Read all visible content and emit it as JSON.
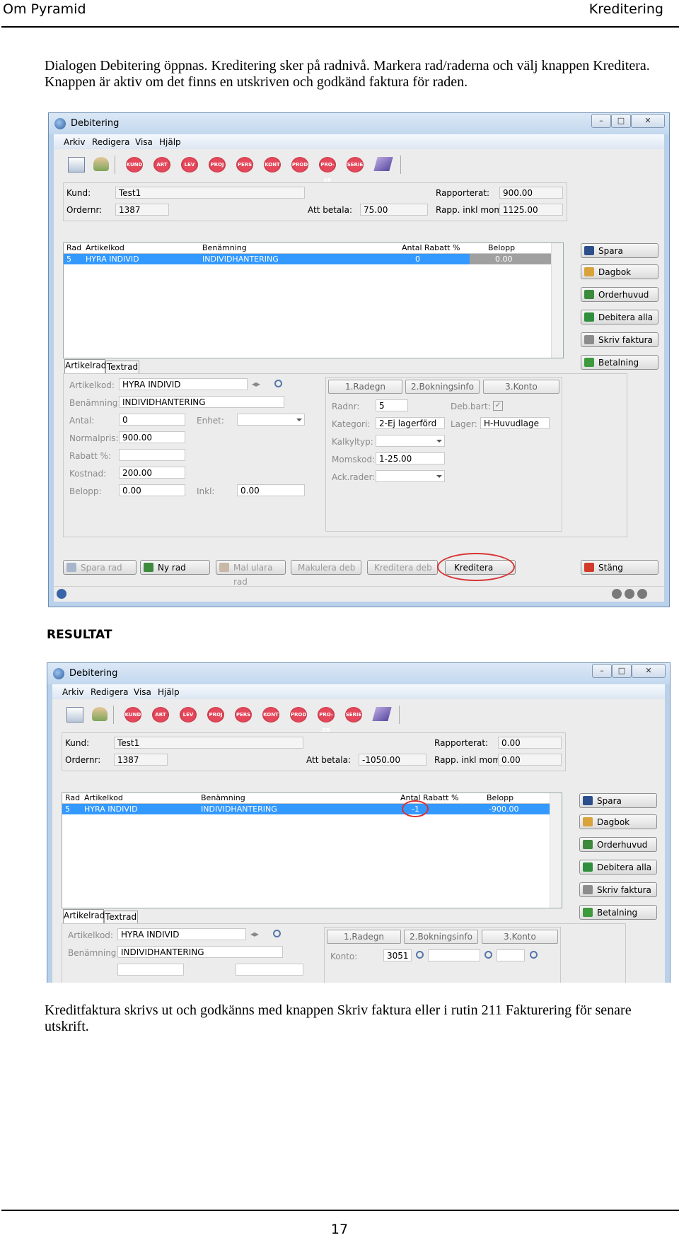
{
  "page": {
    "header_left": "Om Pyramid",
    "header_right": "Kreditering",
    "intro_paragraph": "Dialogen Debitering öppnas. Kreditering sker på radnivå. Markera rad/raderna och välj knappen Kreditera. Knappen är aktiv om det finns en utskriven och godkänd faktura för raden.",
    "result_heading": "RESULTAT",
    "outro_paragraph": "Kreditfaktura skrivs ut och godkänns med knappen Skriv faktura eller i rutin 211 Fakturering för senare utskrift.",
    "page_number": "17"
  },
  "window1": {
    "title": "Debitering",
    "menu": [
      "Arkiv",
      "Redigera",
      "Visa",
      "Hjälp"
    ],
    "toolbar_icons": [
      "KUND",
      "ART",
      "LEV",
      "PROJ",
      "PERS",
      "KONT",
      "PROD",
      "PRO-GR",
      "SERIE"
    ],
    "header": {
      "kund_label": "Kund:",
      "kund_value": "Test1",
      "ordernr_label": "Ordernr:",
      "ordernr_value": "1387",
      "att_betala_label": "Att betala:",
      "att_betala_value": "75.00",
      "rapporterat_label": "Rapporterat:",
      "rapporterat_value": "900.00",
      "rapp_inkl_label": "Rapp. inkl moms:",
      "rapp_inkl_value": "1125.00"
    },
    "grid": {
      "columns": [
        "Rad",
        "Artikelkod",
        "Benämning",
        "Antal",
        "Rabatt %",
        "Belopp"
      ],
      "rows": [
        {
          "rad": "5",
          "artikelkod": "HYRA INDIVID",
          "benamning": "INDIVIDHANTERING",
          "antal": "0",
          "rabatt": "",
          "belopp": "0.00"
        }
      ]
    },
    "side_buttons": [
      "Spara",
      "Dagbok",
      "Orderhuvud",
      "Debitera alla",
      "Skriv faktura",
      "Betalning"
    ],
    "tabs": [
      "Artikelrad",
      "Textrad"
    ],
    "detail": {
      "artikelkod_label": "Artikelkod:",
      "artikelkod_value": "HYRA INDIVID",
      "benamning_label": "Benämning:",
      "benamning_value": "INDIVIDHANTERING",
      "antal_label": "Antal:",
      "antal_value": "0",
      "enhet_label": "Enhet:",
      "normalpris_label": "Normalpris:",
      "normalpris_value": "900.00",
      "rabatt_label": "Rabatt %:",
      "kostnad_label": "Kostnad:",
      "kostnad_value": "200.00",
      "belopp_label": "Belopp:",
      "belopp_value": "0.00",
      "inkl_label": "Inkl:",
      "inkl_value": "0.00"
    },
    "subtabs": [
      "1.Radegn",
      "2.Bokningsinfo",
      "3.Konto"
    ],
    "radegn": {
      "radnr_label": "Radnr:",
      "radnr_value": "5",
      "debbart_label": "Deb.bart:",
      "kategori_label": "Kategori:",
      "kategori_value": "2-Ej lagerförd",
      "lager_label": "Lager:",
      "lager_value": "H-Huvudlage",
      "kalkyltyp_label": "Kalkyltyp:",
      "momskod_label": "Momskod:",
      "momskod_value": "1-25.00",
      "ackrader_label": "Ack.rader:"
    },
    "bottom_buttons": [
      "Spara rad",
      "Ny rad",
      "Mal ulara rad",
      "Makulera deb",
      "Kreditera deb",
      "Kreditera"
    ],
    "close_button": "Stäng"
  },
  "window2": {
    "title": "Debitering",
    "menu": [
      "Arkiv",
      "Redigera",
      "Visa",
      "Hjälp"
    ],
    "toolbar_icons": [
      "KUND",
      "ART",
      "LEV",
      "PROJ",
      "PERS",
      "KONT",
      "PROD",
      "PRO-GR",
      "SERIE"
    ],
    "header": {
      "kund_label": "Kund:",
      "kund_value": "Test1",
      "ordernr_label": "Ordernr:",
      "ordernr_value": "1387",
      "att_betala_label": "Att betala:",
      "att_betala_value": "-1050.00",
      "rapporterat_label": "Rapporterat:",
      "rapporterat_value": "0.00",
      "rapp_inkl_label": "Rapp. inkl moms:",
      "rapp_inkl_value": "0.00"
    },
    "grid": {
      "columns": [
        "Rad",
        "Artikelkod",
        "Benämning",
        "Antal",
        "Rabatt %",
        "Belopp"
      ],
      "rows": [
        {
          "rad": "5",
          "artikelkod": "HYRA INDIVID",
          "benamning": "INDIVIDHANTERING",
          "antal": "-1",
          "rabatt": "",
          "belopp": "-900.00"
        }
      ]
    },
    "side_buttons": [
      "Spara",
      "Dagbok",
      "Orderhuvud",
      "Debitera alla",
      "Skriv faktura",
      "Betalning"
    ],
    "tabs": [
      "Artikelrad",
      "Textrad"
    ],
    "detail": {
      "artikelkod_label": "Artikelkod:",
      "artikelkod_value": "HYRA INDIVID",
      "benamning_label": "Benämning:",
      "benamning_value": "INDIVIDHANTERING"
    },
    "subtabs": [
      "1.Radegn",
      "2.Bokningsinfo",
      "3.Konto"
    ],
    "konto": {
      "konto_label": "Konto:",
      "konto_value": "3051"
    }
  }
}
